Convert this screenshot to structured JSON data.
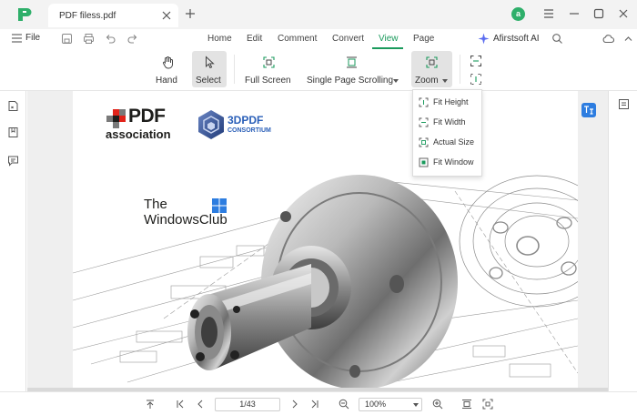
{
  "titlebar": {
    "tab_title": "PDF filess.pdf",
    "avatar_letter": "a"
  },
  "menubar": {
    "file_label": "File",
    "items": [
      "Home",
      "Edit",
      "Comment",
      "Convert",
      "View",
      "Page"
    ],
    "active_item": "View",
    "ai_label": "Afirstsoft AI"
  },
  "toolbar": {
    "tools": [
      {
        "label": "Hand",
        "icon": "hand-icon"
      },
      {
        "label": "Select",
        "icon": "cursor-icon",
        "selected": true
      },
      {
        "label": "Full Screen",
        "icon": "fullscreen-icon"
      },
      {
        "label": "Single Page Scrolling",
        "icon": "single-page-icon"
      },
      {
        "label": "Zoom",
        "icon": "zoom-icon",
        "selected": true
      }
    ]
  },
  "zoom_menu": {
    "items": [
      "Fit Height",
      "Fit Width",
      "Actual Size",
      "Fit Window"
    ]
  },
  "document": {
    "logo_pdf_line1": "PDF",
    "logo_pdf_line2": "association",
    "logo_3dpdf_line1": "3DPDF",
    "logo_3dpdf_line2": "CONSORTIUM",
    "watermark_line1": "The",
    "watermark_line2": "WindowsClub"
  },
  "bottombar": {
    "page_value": "1/43",
    "zoom_value": "100%"
  },
  "colors": {
    "accent": "#1a9a5c",
    "logo_green": "#2eaf6a",
    "translate_blue": "#2d7de0"
  }
}
